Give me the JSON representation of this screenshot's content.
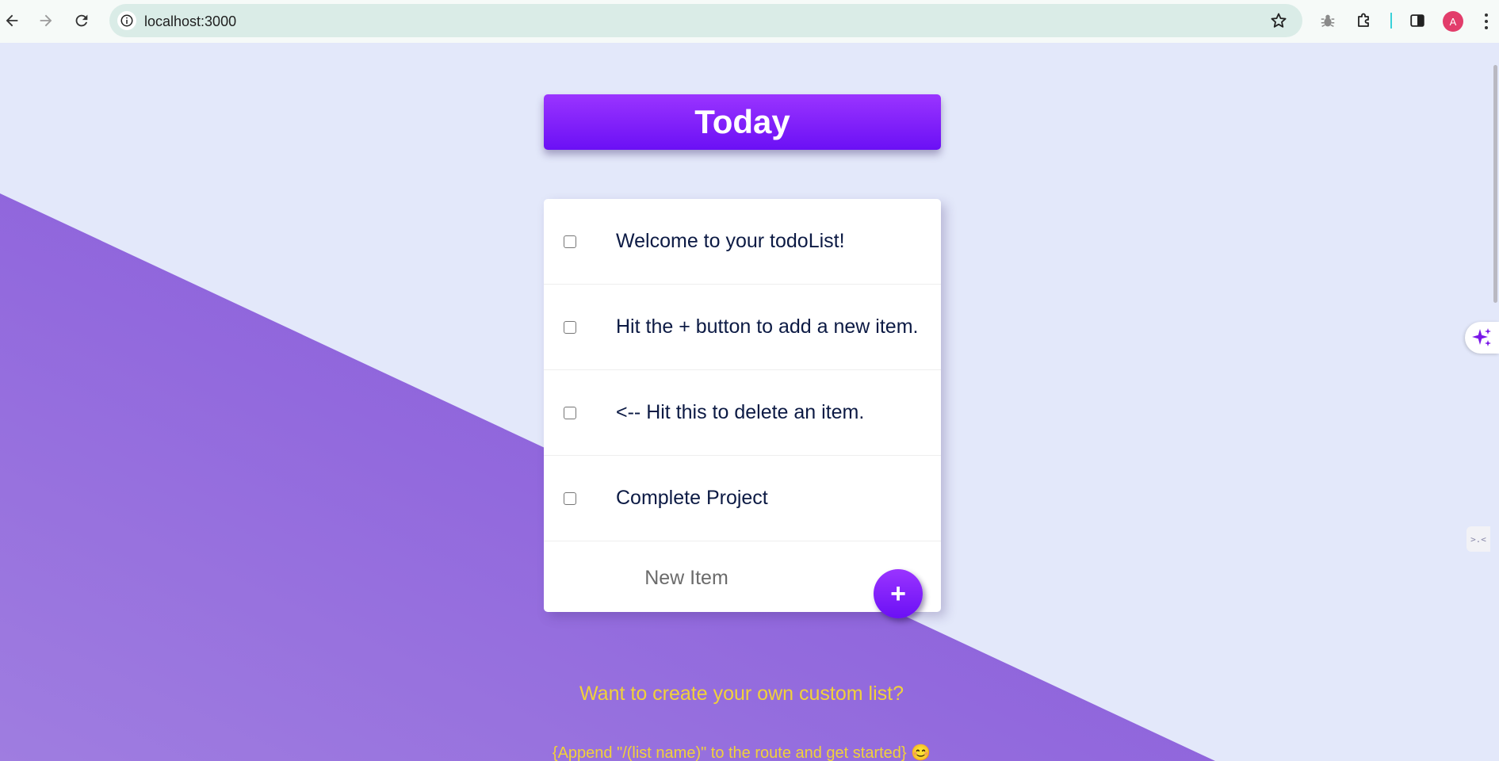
{
  "browser": {
    "url": "localhost:3000",
    "avatar_letter": "A"
  },
  "list": {
    "title": "Today",
    "items": [
      {
        "text": "Welcome to your todoList!",
        "checked": false
      },
      {
        "text": "Hit the + button to add a new item.",
        "checked": false
      },
      {
        "text": "<-- Hit this to delete an item.",
        "checked": false
      },
      {
        "text": "Complete Project",
        "checked": false
      }
    ],
    "new_item_placeholder": "New Item",
    "add_button_label": "+"
  },
  "promo": {
    "title": "Want to create your own custom list?",
    "hint": "{Append \"/(list name)\" to the route and get started} 😊"
  },
  "sidebar": {
    "tab_glyph": ">.<"
  },
  "colors": {
    "background": "#e3e8fa",
    "diagonal_purple": "#8d5fdd",
    "accent": "#7c1ff8",
    "promo_text": "#f1d13a",
    "item_text": "#0c1a44"
  }
}
